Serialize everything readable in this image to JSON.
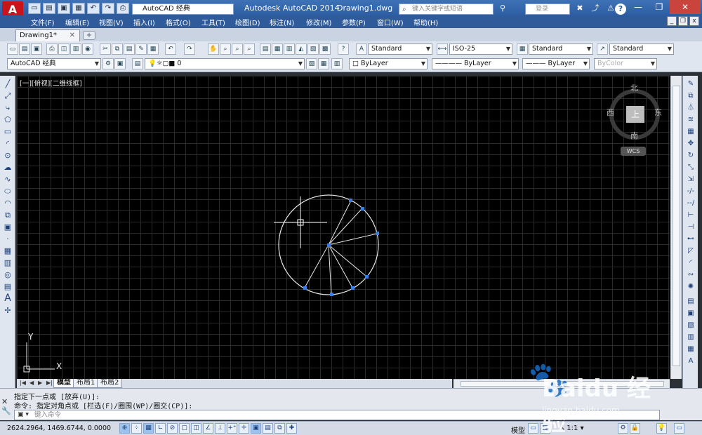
{
  "titlebar": {
    "logo": "A",
    "workspace": "AutoCAD 经典",
    "app_title": "Autodesk AutoCAD 2014",
    "file_title": "Drawing1.dwg",
    "search_placeholder": "键入关键字或短语",
    "user_placeholder": "登录",
    "help": "?",
    "min": "—",
    "restore": "❐",
    "close": "✕"
  },
  "menu": {
    "items": [
      "文件(F)",
      "编辑(E)",
      "视图(V)",
      "插入(I)",
      "格式(O)",
      "工具(T)",
      "绘图(D)",
      "标注(N)",
      "修改(M)",
      "参数(P)",
      "窗口(W)",
      "帮助(H)"
    ]
  },
  "tabs": {
    "doc_tab": "Drawing1*",
    "close": "✕",
    "new_tab": "+"
  },
  "toolbar": {
    "text_style": "Standard",
    "dim_style": "ISO-25",
    "table_style": "Standard",
    "multileader_style": "Standard",
    "workspace_combo": "AutoCAD 经典",
    "layer": "0",
    "color": "ByLayer",
    "linetype": "ByLayer",
    "lineweight": "ByLayer",
    "plotstyle": "ByColor"
  },
  "viewport": {
    "label": "[一][俯视][二维线框]",
    "viewcube": {
      "north": "北",
      "south": "南",
      "east": "东",
      "west": "西",
      "face": "上",
      "wcs": "WCS"
    },
    "ucs_x": "X",
    "ucs_y": "Y"
  },
  "layout": {
    "model": "模型",
    "layout1": "布局1",
    "layout2": "布局2"
  },
  "command": {
    "history": [
      "指定下一点或 [放弃(U)]:",
      "命令: 指定对角点或 [栏选(F)/圈围(WP)/圈交(CP)]:"
    ],
    "placeholder": "键入命令"
  },
  "status": {
    "coords": "2624.2964, 1469.6744, 0.0000",
    "model": "模型",
    "scale": "1:1"
  },
  "watermark": {
    "brand": "Baidu 经验",
    "url": "jingyan.baidu.com"
  }
}
